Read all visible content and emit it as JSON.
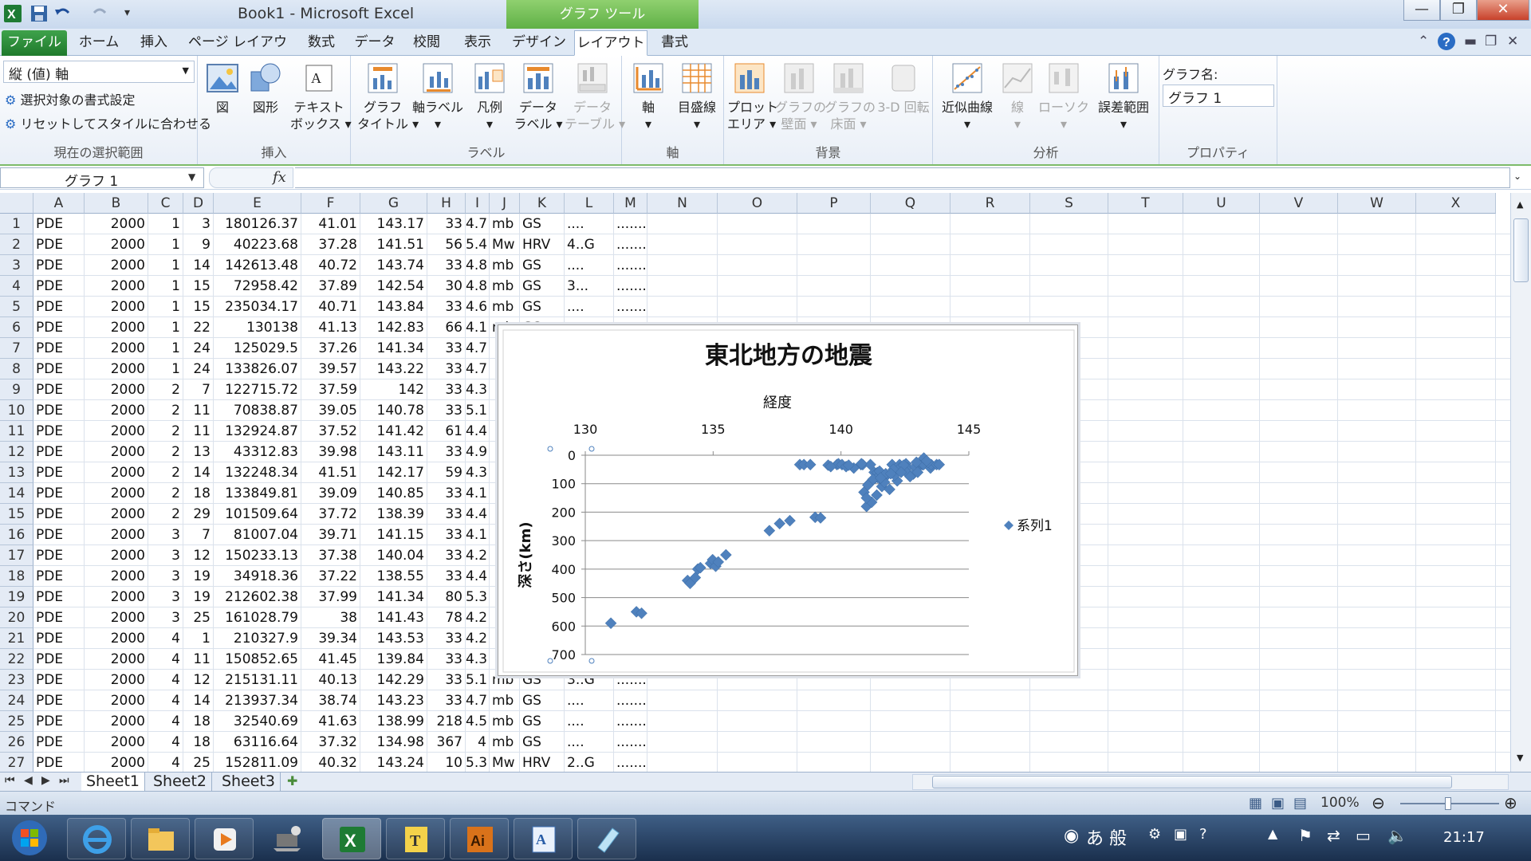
{
  "titlebar": {
    "title": "Book1 - Microsoft Excel",
    "context_tools": "グラフ ツール",
    "minimize": "—",
    "maximize": "❐",
    "close": "✕"
  },
  "ribbon_tabs": [
    "ファイル",
    "ホーム",
    "挿入",
    "ページ レイアウト",
    "数式",
    "データ",
    "校閲",
    "表示",
    "デザイン",
    "レイアウト",
    "書式"
  ],
  "ribbon": {
    "selection_combo": "縦 (値) 軸",
    "format_selection": "選択対象の書式設定",
    "reset_style": "リセットしてスタイルに合わせる",
    "group_current_selection": "現在の選択範囲",
    "insert": {
      "picture": "図",
      "shapes": "図形",
      "textbox_1": "テキスト",
      "textbox_2": "ボックス ▾",
      "group": "挿入"
    },
    "labels": {
      "chart_title_1": "グラフ",
      "chart_title_2": "タイトル ▾",
      "axis_titles": "軸ラベル",
      "legend": "凡例",
      "data_labels_1": "データ",
      "data_labels_2": "ラベル ▾",
      "data_table_1": "データ",
      "data_table_2": "テーブル ▾",
      "group": "ラベル"
    },
    "axes": {
      "axes": "軸",
      "gridlines": "目盛線",
      "group": "軸"
    },
    "background": {
      "plot_area_1": "プロット",
      "plot_area_2": "エリア ▾",
      "chart_wall_1": "グラフの",
      "chart_wall_2": "壁面 ▾",
      "chart_floor_1": "グラフの",
      "chart_floor_2": "床面 ▾",
      "rotation": "3-D 回転",
      "group": "背景"
    },
    "analysis": {
      "trendline": "近似曲線",
      "lines": "線",
      "updown": "ローソク",
      "error_bars": "誤差範囲",
      "group": "分析"
    },
    "properties": {
      "chart_name_label": "グラフ名:",
      "chart_name_value": "グラフ 1",
      "group": "プロパティ"
    }
  },
  "formula_bar": {
    "name_box": "グラフ 1",
    "fx": "fx",
    "formula": ""
  },
  "columns": [
    "A",
    "B",
    "C",
    "D",
    "E",
    "F",
    "G",
    "H",
    "I",
    "J",
    "K",
    "L",
    "M",
    "N",
    "O",
    "P",
    "Q",
    "R",
    "S",
    "T",
    "U",
    "V",
    "W",
    "X"
  ],
  "rows": [
    [
      "1",
      "PDE",
      "2000",
      "1",
      "3",
      "180126.37",
      "41.01",
      "143.17",
      "33",
      "4.7",
      "mb",
      "GS",
      "....",
      "......."
    ],
    [
      "2",
      "PDE",
      "2000",
      "1",
      "9",
      "40223.68",
      "37.28",
      "141.51",
      "56",
      "5.4",
      "Mw",
      "HRV",
      "4..G",
      "......."
    ],
    [
      "3",
      "PDE",
      "2000",
      "1",
      "14",
      "142613.48",
      "40.72",
      "143.74",
      "33",
      "4.8",
      "mb",
      "GS",
      "....",
      "......."
    ],
    [
      "4",
      "PDE",
      "2000",
      "1",
      "15",
      "72958.42",
      "37.89",
      "142.54",
      "30",
      "4.8",
      "mb",
      "GS",
      "3...",
      "......."
    ],
    [
      "5",
      "PDE",
      "2000",
      "1",
      "15",
      "235034.17",
      "40.71",
      "143.84",
      "33",
      "4.6",
      "mb",
      "GS",
      "....",
      "......."
    ],
    [
      "6",
      "PDE",
      "2000",
      "1",
      "22",
      "130138",
      "41.13",
      "142.83",
      "66",
      "4.1",
      "mb",
      "GS",
      "",
      ""
    ],
    [
      "7",
      "PDE",
      "2000",
      "1",
      "24",
      "125029.5",
      "37.26",
      "141.34",
      "33",
      "4.7",
      "",
      "",
      "",
      ""
    ],
    [
      "8",
      "PDE",
      "2000",
      "1",
      "24",
      "133826.07",
      "39.57",
      "143.22",
      "33",
      "4.7",
      "",
      "",
      "",
      ""
    ],
    [
      "9",
      "PDE",
      "2000",
      "2",
      "7",
      "122715.72",
      "37.59",
      "142",
      "33",
      "4.3",
      "",
      "",
      "",
      ""
    ],
    [
      "10",
      "PDE",
      "2000",
      "2",
      "11",
      "70838.87",
      "39.05",
      "140.78",
      "33",
      "5.1",
      "",
      "",
      "",
      ""
    ],
    [
      "11",
      "PDE",
      "2000",
      "2",
      "11",
      "132924.87",
      "37.52",
      "141.42",
      "61",
      "4.4",
      "",
      "",
      "",
      ""
    ],
    [
      "12",
      "PDE",
      "2000",
      "2",
      "13",
      "43312.83",
      "39.98",
      "143.11",
      "33",
      "4.9",
      "",
      "",
      "",
      ""
    ],
    [
      "13",
      "PDE",
      "2000",
      "2",
      "14",
      "132248.34",
      "41.51",
      "142.17",
      "59",
      "4.3",
      "",
      "",
      "",
      ""
    ],
    [
      "14",
      "PDE",
      "2000",
      "2",
      "18",
      "133849.81",
      "39.09",
      "140.85",
      "33",
      "4.1",
      "",
      "",
      "",
      ""
    ],
    [
      "15",
      "PDE",
      "2000",
      "2",
      "29",
      "101509.64",
      "37.72",
      "138.39",
      "33",
      "4.4",
      "",
      "",
      "",
      ""
    ],
    [
      "16",
      "PDE",
      "2000",
      "3",
      "7",
      "81007.04",
      "39.71",
      "141.15",
      "33",
      "4.1",
      "",
      "",
      "",
      ""
    ],
    [
      "17",
      "PDE",
      "2000",
      "3",
      "12",
      "150233.13",
      "37.38",
      "140.04",
      "33",
      "4.2",
      "",
      "",
      "",
      ""
    ],
    [
      "18",
      "PDE",
      "2000",
      "3",
      "19",
      "34918.36",
      "37.22",
      "138.55",
      "33",
      "4.4",
      "",
      "",
      "",
      ""
    ],
    [
      "19",
      "PDE",
      "2000",
      "3",
      "19",
      "212602.38",
      "37.99",
      "141.34",
      "80",
      "5.3",
      "",
      "",
      "",
      ""
    ],
    [
      "20",
      "PDE",
      "2000",
      "3",
      "25",
      "161028.79",
      "38",
      "141.43",
      "78",
      "4.2",
      "",
      "",
      "",
      ""
    ],
    [
      "21",
      "PDE",
      "2000",
      "4",
      "1",
      "210327.9",
      "39.34",
      "143.53",
      "33",
      "4.2",
      "",
      "",
      "",
      ""
    ],
    [
      "22",
      "PDE",
      "2000",
      "4",
      "11",
      "150852.65",
      "41.45",
      "139.84",
      "33",
      "4.3",
      "",
      "",
      "",
      ""
    ],
    [
      "23",
      "PDE",
      "2000",
      "4",
      "12",
      "215131.11",
      "40.13",
      "142.29",
      "33",
      "5.1",
      "mb",
      "GS",
      "3..G",
      "......."
    ],
    [
      "24",
      "PDE",
      "2000",
      "4",
      "14",
      "213937.34",
      "38.74",
      "143.23",
      "33",
      "4.7",
      "mb",
      "GS",
      "....",
      "......."
    ],
    [
      "25",
      "PDE",
      "2000",
      "4",
      "18",
      "32540.69",
      "41.63",
      "138.99",
      "218",
      "4.5",
      "mb",
      "GS",
      "....",
      "......."
    ],
    [
      "26",
      "PDE",
      "2000",
      "4",
      "18",
      "63116.64",
      "37.32",
      "134.98",
      "367",
      "4",
      "mb",
      "GS",
      "....",
      "......."
    ],
    [
      "27",
      "PDE",
      "2000",
      "4",
      "25",
      "152811.09",
      "40.32",
      "143.24",
      "10",
      "5.3",
      "Mw",
      "HRV",
      "2..G",
      "......."
    ]
  ],
  "sheets": [
    "Sheet1",
    "Sheet2",
    "Sheet3"
  ],
  "status": {
    "mode": "コマンド",
    "zoom": "100%"
  },
  "taskbar": {
    "clock": "21:17",
    "ime": "あ 般"
  },
  "chart_data": {
    "type": "scatter",
    "title": "東北地方の地震",
    "xlabel": "経度",
    "ylabel": "深さ(km)",
    "xlim": [
      130,
      145
    ],
    "ylim": [
      0,
      700
    ],
    "y_reversed": true,
    "x_axis_position": "top",
    "xticks": [
      "130",
      "135",
      "140",
      "145"
    ],
    "yticks": [
      "0",
      "100",
      "200",
      "300",
      "400",
      "500",
      "600",
      "700"
    ],
    "grid": true,
    "legend": "right",
    "color": "#4f81bd",
    "series": [
      {
        "name": "系列1",
        "x": [
          131.0,
          132.0,
          132.2,
          134.0,
          134.1,
          134.3,
          134.4,
          134.5,
          134.9,
          134.98,
          135.1,
          135.2,
          135.5,
          137.2,
          137.6,
          138.0,
          138.39,
          138.55,
          138.8,
          138.99,
          139.2,
          139.5,
          139.84,
          139.9,
          140.04,
          140.2,
          140.78,
          140.85,
          140.9,
          141.0,
          141.15,
          141.2,
          141.3,
          141.34,
          141.42,
          141.43,
          141.51,
          141.6,
          141.8,
          142.0,
          142.17,
          142.29,
          142.4,
          142.54,
          142.6,
          142.83,
          142.9,
          143.11,
          143.17,
          143.22,
          143.23,
          143.24,
          143.5,
          143.53,
          143.74,
          143.84,
          141.1,
          141.6,
          142.2,
          142.7,
          143.0,
          140.5,
          141.9,
          142.1,
          139.6,
          140.3,
          141.7,
          142.5,
          143.4,
          142.3,
          141.0,
          141.4,
          140.8,
          141.25,
          141.75,
          142.05,
          142.45,
          142.95,
          143.35,
          141.05,
          141.55,
          141.95,
          142.35
        ],
        "y": [
          590,
          550,
          555,
          440,
          450,
          430,
          400,
          395,
          380,
          367,
          390,
          375,
          350,
          265,
          240,
          230,
          33,
          33,
          33,
          218,
          220,
          35,
          33,
          30,
          33,
          40,
          33,
          33,
          130,
          180,
          33,
          165,
          60,
          80,
          61,
          78,
          56,
          90,
          70,
          33,
          59,
          33,
          50,
          30,
          45,
          66,
          40,
          33,
          33,
          33,
          33,
          10,
          45,
          33,
          33,
          33,
          100,
          110,
          90,
          75,
          60,
          45,
          120,
          70,
          40,
          35,
          95,
          55,
          25,
          45,
          150,
          140,
          30,
          85,
          65,
          50,
          35,
          25,
          20,
          105,
          80,
          65,
          60
        ]
      }
    ]
  }
}
